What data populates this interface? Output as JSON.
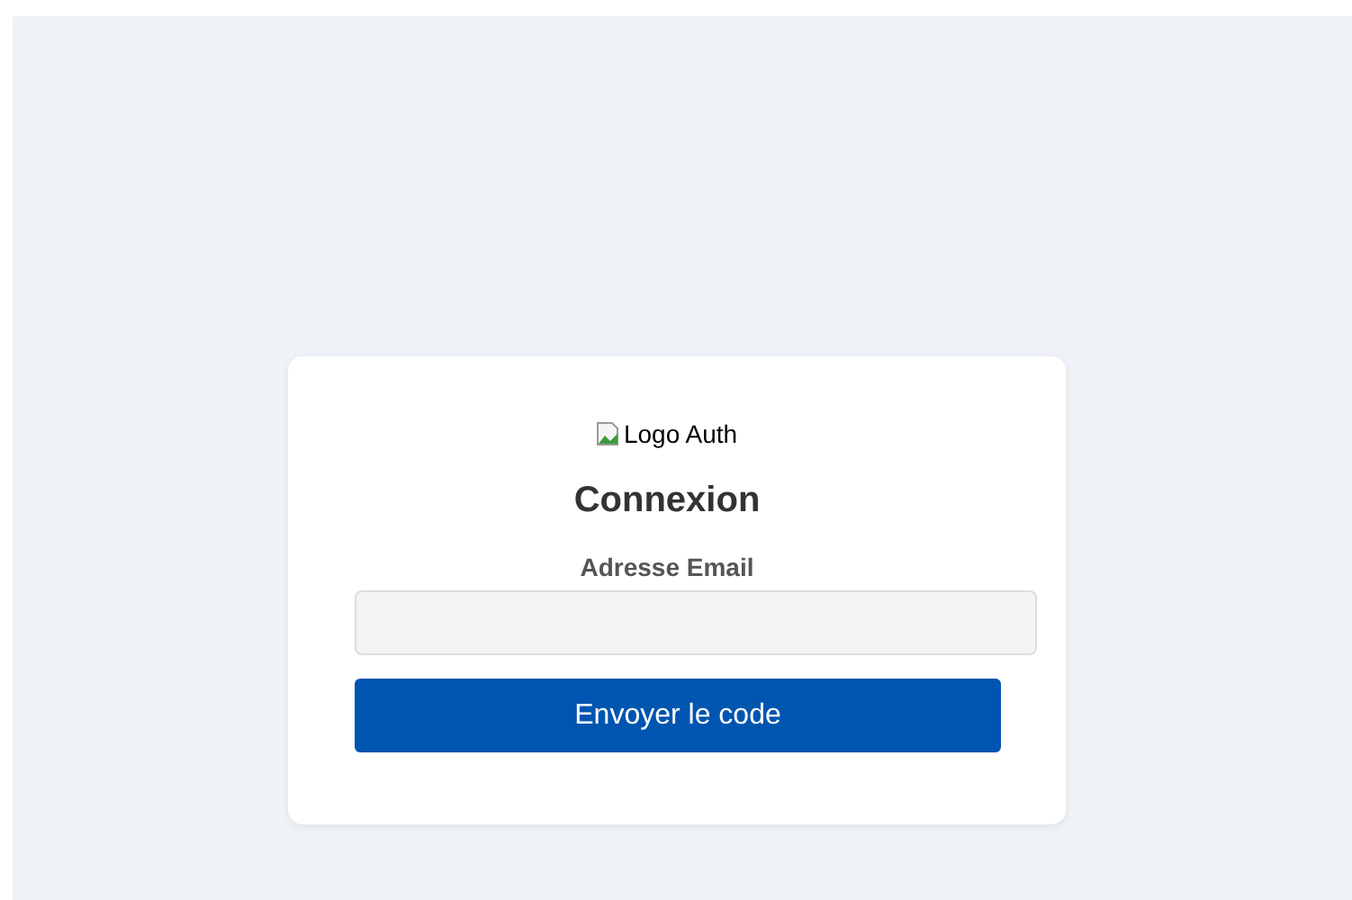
{
  "logo": {
    "alt": "Logo Auth"
  },
  "title": "Connexion",
  "email_field": {
    "label": "Adresse Email"
  },
  "submit_button": {
    "label": "Envoyer le code"
  }
}
